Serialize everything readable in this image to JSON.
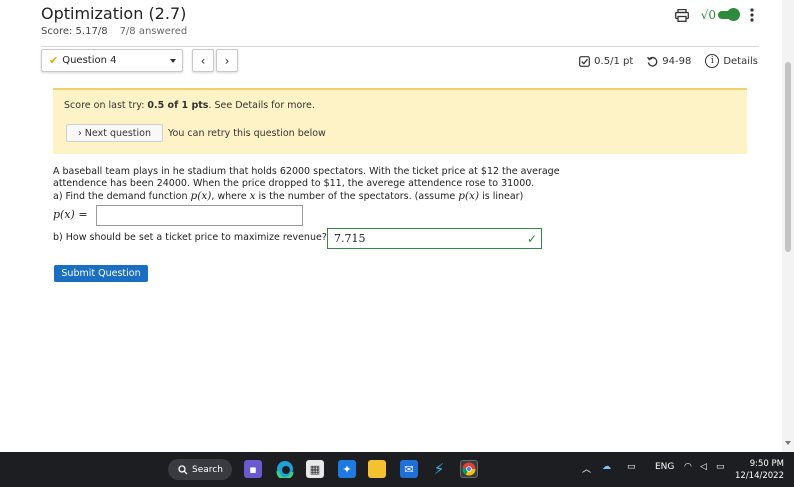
{
  "header": {
    "title": "Optimization (2.7)",
    "score": "Score: 5.17/8",
    "answered": "7/8 answered"
  },
  "toolbar": {
    "question_select": "Question 4",
    "prev_label": "‹",
    "next_label": "›",
    "points": "0.5/1 pt",
    "retries": "94-98",
    "details": "Details"
  },
  "notice": {
    "prefix": "Score on last try: ",
    "score": "0.5 of 1 pts",
    "suffix": ". See Details for more.",
    "next_question": "› Next question",
    "retry": "You can retry this question below"
  },
  "problem": {
    "line1": "A baseball team plays in he stadium that holds 62000 spectators. With the ticket price at $12 the average",
    "line2": "attendence has been 24000. When the price dropped to $11, the averege attendence rose to 31000.",
    "line3_a": "a) Find the demand function ",
    "line3_px1": "p(x)",
    "line3_b": ", where ",
    "line3_x": "x",
    "line3_c": " is the number of the spectators. (assume ",
    "line3_px2": "p(x)",
    "line3_d": " is linear)",
    "px_label": "p(x) =",
    "px_value": "",
    "partb": "b) How should be set a ticket price to maximize revenue? $",
    "partb_value": "7.715"
  },
  "actions": {
    "submit": "Submit Question"
  },
  "taskbar": {
    "search": "Search",
    "lang": "ENG",
    "time": "9:50 PM",
    "date": "12/14/2022"
  },
  "colors": {
    "accent": "#1b6fc0",
    "correct": "#2e8b3d",
    "notice_bg": "#fdf3c6"
  }
}
